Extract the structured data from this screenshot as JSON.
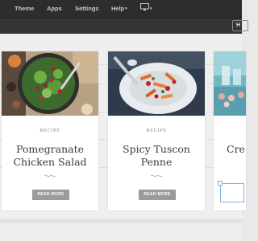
{
  "menu": {
    "theme": "Theme",
    "apps": "Apps",
    "settings": "Settings",
    "help": "Help"
  },
  "edge_button": "H",
  "cards": [
    {
      "label": "RECIPE",
      "title": "Pomegranate Chicken Salad",
      "button": "READ MORE"
    },
    {
      "label": "RECIPE",
      "title": "Spicy Tuscon Penne",
      "button": "READ MORE"
    },
    {
      "title": "Cre"
    }
  ],
  "colors": {
    "topbar": "#2b2d2f",
    "button": "#9b9b9b",
    "squiggle": "#e08a8a",
    "selection": "#7fb2e5"
  }
}
